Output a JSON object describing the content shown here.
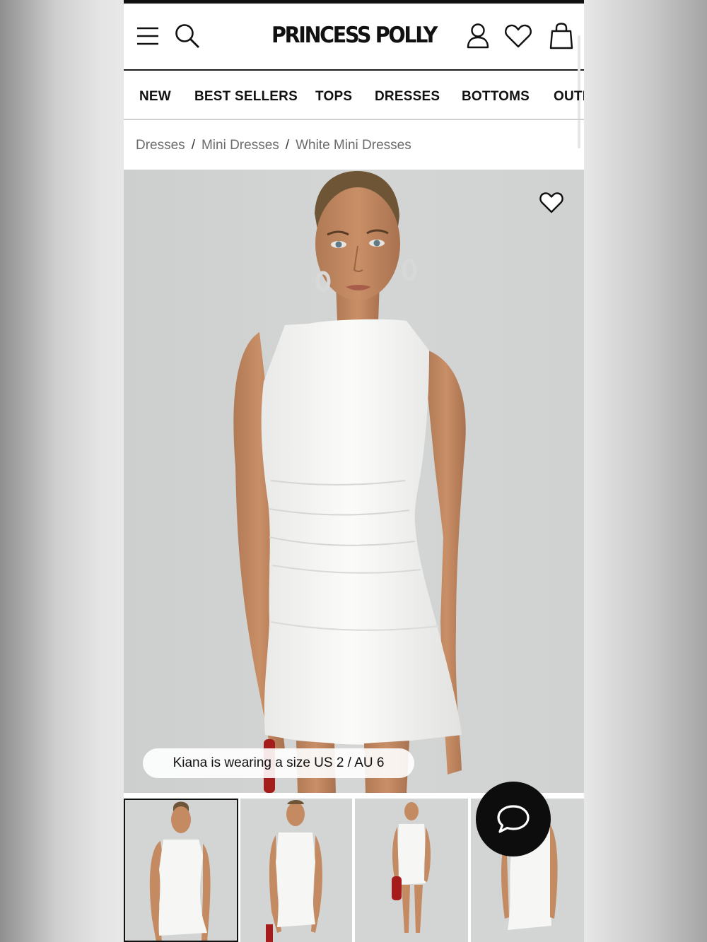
{
  "brand": {
    "logo_text": "PRINCESS POLLY"
  },
  "header": {
    "icons": [
      "menu-icon",
      "search-icon",
      "account-icon",
      "wishlist-icon",
      "bag-icon"
    ]
  },
  "nav": {
    "items": [
      "NEW",
      "BEST SELLERS",
      "TOPS",
      "DRESSES",
      "BOTTOMS",
      "OUTI"
    ]
  },
  "breadcrumb": {
    "items": [
      "Dresses",
      "Mini Dresses",
      "White Mini Dresses"
    ],
    "separator": "/"
  },
  "product": {
    "model_size_note": "Kiana is wearing a size US 2 / AU 6",
    "thumbnail_count": 4,
    "active_thumbnail": 1,
    "dress_color": "#f7f7f5"
  },
  "chat": {
    "icon": "chat-bubble-icon"
  },
  "colors": {
    "text": "#111111",
    "breadcrumb": "#6b6b6b",
    "photo_bg": "#d2d4d4"
  }
}
